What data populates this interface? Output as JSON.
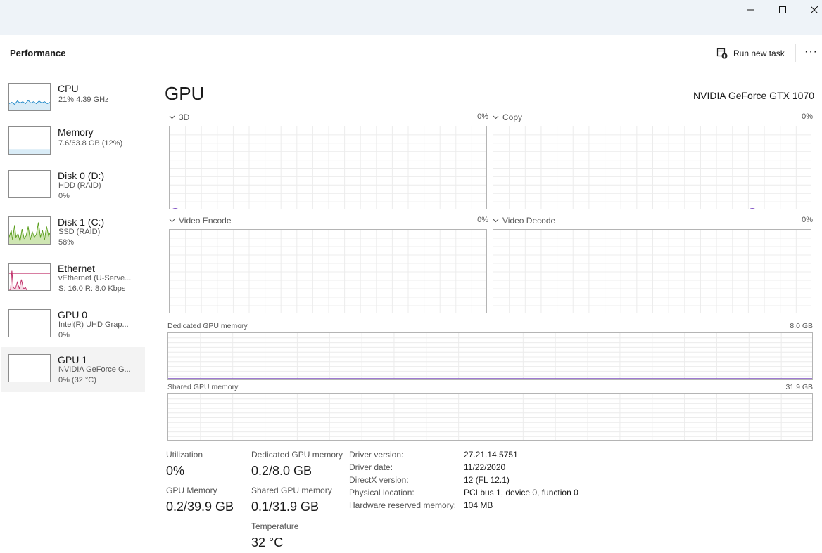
{
  "window": {
    "title": "Performance",
    "run_new_task": "Run new task",
    "more": "···"
  },
  "sidebar": {
    "items": [
      {
        "name": "CPU",
        "line1": "21% 4.39 GHz",
        "line2": "",
        "color": "#1e88c8",
        "fill": "#d9ecf7"
      },
      {
        "name": "Memory",
        "line1": "7.6/63.8 GB (12%)",
        "line2": "",
        "color": "#1e88c8",
        "fill": "#d9ecf7"
      },
      {
        "name": "Disk 0 (D:)",
        "line1": "HDD (RAID)",
        "line2": "0%",
        "color": "#5b9e1f",
        "fill": "#e6f2d9"
      },
      {
        "name": "Disk 1 (C:)",
        "line1": "SSD (RAID)",
        "line2": "58%",
        "color": "#5b9e1f",
        "fill": "#cfe6b3"
      },
      {
        "name": "Ethernet",
        "line1": "vEthernet (U-Serve...",
        "line2": "S: 16.0 R: 8.0 Kbps",
        "color": "#c0306a",
        "fill": "#f7dce7"
      },
      {
        "name": "GPU 0",
        "line1": "Intel(R) UHD Grap...",
        "line2": "0%",
        "color": "#7f4fc3",
        "fill": "#ece3f7"
      },
      {
        "name": "GPU 1",
        "line1": "NVIDIA GeForce G...",
        "line2": "0% (32 °C)",
        "color": "#7f4fc3",
        "fill": "#ece3f7",
        "selected": true
      }
    ]
  },
  "main": {
    "title": "GPU",
    "model": "NVIDIA GeForce GTX 1070",
    "engines": [
      {
        "label": "3D",
        "pct": "0%"
      },
      {
        "label": "Copy",
        "pct": "0%"
      },
      {
        "label": "Video Encode",
        "pct": "0%"
      },
      {
        "label": "Video Decode",
        "pct": "0%"
      }
    ],
    "dedicated_memory": {
      "label": "Dedicated GPU memory",
      "max": "8.0 GB"
    },
    "shared_memory": {
      "label": "Shared GPU memory",
      "max": "31.9 GB"
    },
    "accent": "#7f4fc3",
    "stats": {
      "utilization": {
        "label": "Utilization",
        "value": "0%"
      },
      "dedicated": {
        "label": "Dedicated GPU memory",
        "value": "0.2/8.0 GB"
      },
      "gpu_memory": {
        "label": "GPU Memory",
        "value": "0.2/39.9 GB"
      },
      "shared": {
        "label": "Shared GPU memory",
        "value": "0.1/31.9 GB"
      },
      "temperature": {
        "label": "Temperature",
        "value": "32 °C"
      }
    },
    "info": [
      {
        "key": "Driver version:",
        "value": "27.21.14.5751"
      },
      {
        "key": "Driver date:",
        "value": "11/22/2020"
      },
      {
        "key": "DirectX version:",
        "value": "12 (FL 12.1)"
      },
      {
        "key": "Physical location:",
        "value": "PCI bus 1, device 0, function 0"
      },
      {
        "key": "Hardware reserved memory:",
        "value": "104 MB"
      }
    ]
  }
}
